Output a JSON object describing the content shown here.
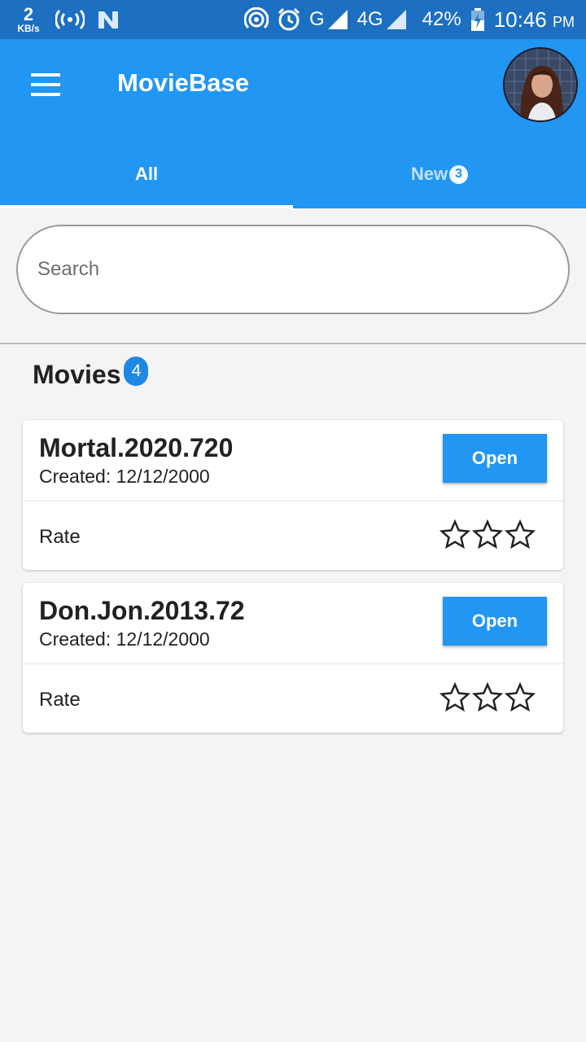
{
  "status_bar": {
    "speed_value": "2",
    "speed_unit": "KB/s",
    "network_left": "G",
    "network_right": "4G",
    "battery": "42%",
    "time": "10:46",
    "ampm": "PM",
    "icons": [
      "hotspot-icon",
      "n-icon",
      "wifi-icon",
      "alarm-icon",
      "signal-icon",
      "battery-icon"
    ]
  },
  "app_bar": {
    "title": "MovieBase",
    "accent_color": "#2196f3"
  },
  "tabs": [
    {
      "label": "All",
      "active": true
    },
    {
      "label": "New",
      "badge": "3",
      "active": false
    }
  ],
  "search": {
    "placeholder": "Search",
    "value": ""
  },
  "section": {
    "title": "Movies",
    "count": "4"
  },
  "movies": [
    {
      "title": "Mortal.2020.720",
      "created": "Created: 12/12/2000",
      "open_label": "Open",
      "rate_label": "Rate",
      "rating": 0,
      "max_rating": 3
    },
    {
      "title": "Don.Jon.2013.72",
      "created": "Created: 12/12/2000",
      "open_label": "Open",
      "rate_label": "Rate",
      "rating": 0,
      "max_rating": 3
    }
  ]
}
